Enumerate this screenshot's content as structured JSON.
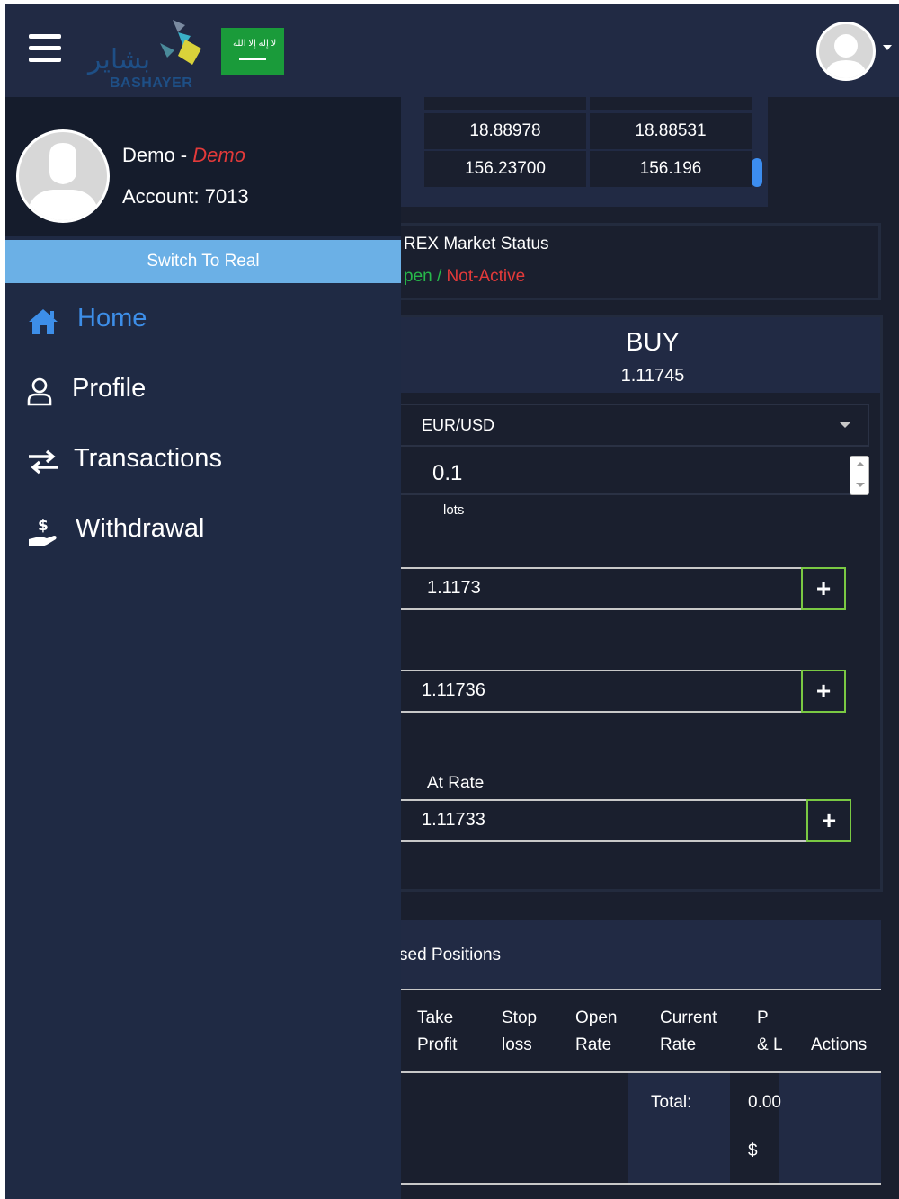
{
  "header": {
    "logo_text": "BASHAYER",
    "logo_arabic": "بشاير",
    "flag_script": "لا إله إلا الله"
  },
  "quotes": {
    "rows": [
      [
        "18.88978",
        "18.88531"
      ],
      [
        "156.23700",
        "156.196"
      ]
    ]
  },
  "market": {
    "title": "REX Market Status",
    "open_label": "pen",
    "separator": " / ",
    "not_active_label": "Not-Active"
  },
  "buy": {
    "title": "BUY",
    "price": "1.11745",
    "symbol": "EUR/USD",
    "lots_value": "0.1",
    "lots_label": "lots",
    "take_profit_value": "1.1173",
    "stop_loss_value": "1.11736",
    "at_rate_label": "At Rate",
    "at_rate_value": "1.11733",
    "plus_symbol": "+"
  },
  "positions": {
    "title": "sed Positions",
    "columns": [
      [
        "Take",
        "Profit"
      ],
      [
        "Stop",
        "loss"
      ],
      [
        "Open",
        "Rate"
      ],
      [
        "Current",
        "Rate"
      ],
      [
        "P",
        "& L"
      ],
      [
        "Actions",
        ""
      ]
    ],
    "total_label": "Total:",
    "total_value": "0.00",
    "total_currency": "$"
  },
  "sidebar": {
    "account_name": "Demo",
    "name_separator": " - ",
    "account_mode": "Demo",
    "account_number": "Account: 7013",
    "switch_label": "Switch To Real",
    "items": [
      {
        "label": "Home",
        "icon": "home-icon",
        "active": true
      },
      {
        "label": "Profile",
        "icon": "user-icon",
        "active": false
      },
      {
        "label": "Transactions",
        "icon": "exchange-icon",
        "active": false
      },
      {
        "label": "Withdrawal",
        "icon": "hand-dollar-icon",
        "active": false
      }
    ]
  },
  "colors": {
    "accent": "#3d8ee8",
    "switch_bg": "#6bb0e6",
    "danger": "#e33a3a",
    "success": "#27b84a",
    "plus_border": "#7ac943"
  }
}
